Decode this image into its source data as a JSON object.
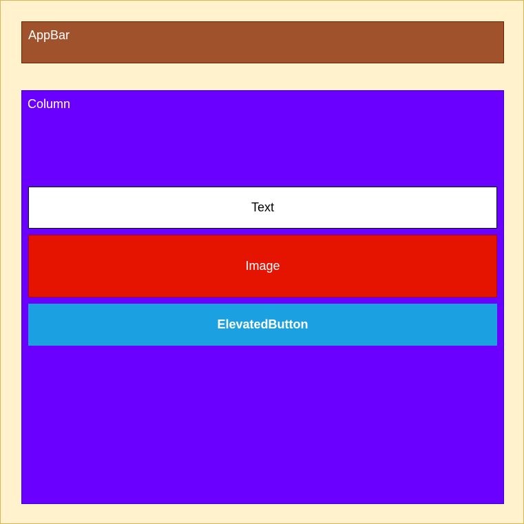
{
  "appbar": {
    "label": "AppBar"
  },
  "column": {
    "label": "Column"
  },
  "text_widget": {
    "label": "Text"
  },
  "image_widget": {
    "label": "Image"
  },
  "button_widget": {
    "label": "ElevatedButton"
  },
  "colors": {
    "background": "#fff2cc",
    "appbar": "#a0522d",
    "column": "#6a00ff",
    "text": "#ffffff",
    "image": "#e51400",
    "button": "#1ba1e2"
  }
}
